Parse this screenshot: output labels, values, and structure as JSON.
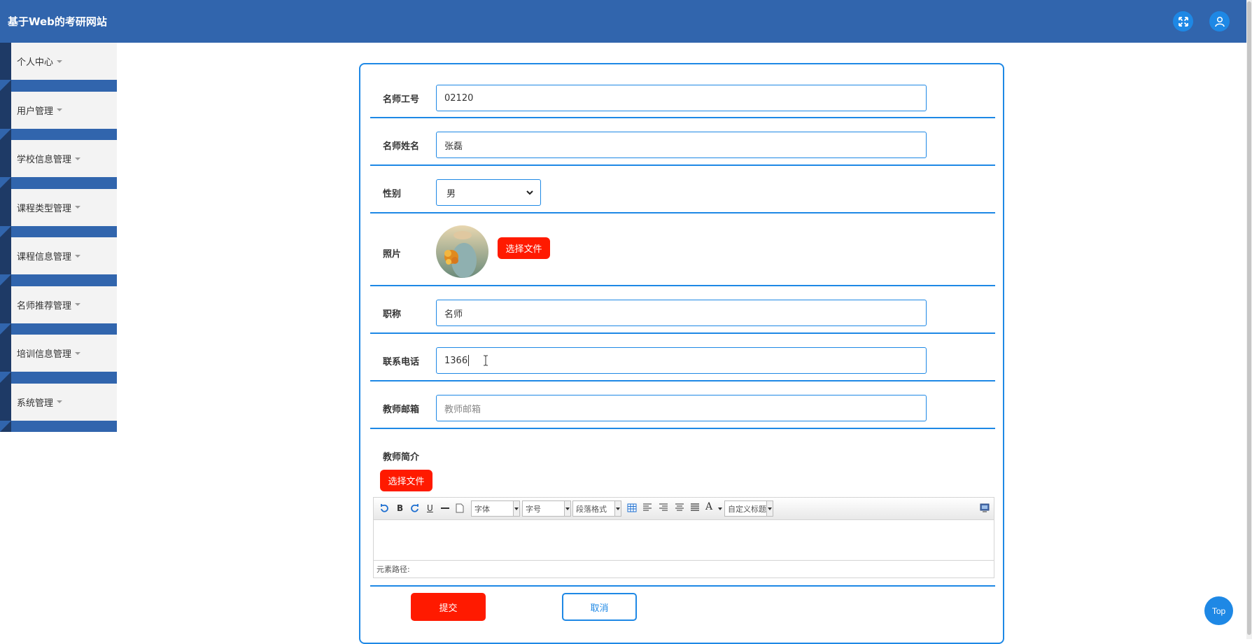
{
  "header": {
    "title": "基于Web的考研网站",
    "fullscreen_icon": "expand-icon",
    "user_icon": "user-icon"
  },
  "sidebar": {
    "items": [
      {
        "label": "个人中心"
      },
      {
        "label": "用户管理"
      },
      {
        "label": "学校信息管理"
      },
      {
        "label": "课程类型管理"
      },
      {
        "label": "课程信息管理"
      },
      {
        "label": "名师推荐管理"
      },
      {
        "label": "培训信息管理"
      },
      {
        "label": "系统管理"
      }
    ]
  },
  "form": {
    "teacher_id": {
      "label": "名师工号",
      "value": "02120"
    },
    "teacher_name": {
      "label": "名师姓名",
      "value": "张磊"
    },
    "gender": {
      "label": "性别",
      "value": "男"
    },
    "photo": {
      "label": "照片",
      "button": "选择文件"
    },
    "job_title": {
      "label": "职称",
      "value": "名师"
    },
    "phone": {
      "label": "联系电话",
      "value": "1366"
    },
    "email": {
      "label": "教师邮箱",
      "placeholder": "教师邮箱"
    },
    "intro": {
      "label": "教师简介",
      "button": "选择文件"
    },
    "submit": "提交",
    "cancel": "取消"
  },
  "editor": {
    "font_family": "字体",
    "font_size": "字号",
    "paragraph": "段落格式",
    "custom_title": "自定义标题",
    "bold": "B",
    "underline": "U",
    "font_color": "A",
    "element_path": "元素路径:"
  },
  "top_button": "Top",
  "colors": {
    "header": "#3165ad",
    "accent": "#1e88e5",
    "danger": "#ff1a00"
  }
}
